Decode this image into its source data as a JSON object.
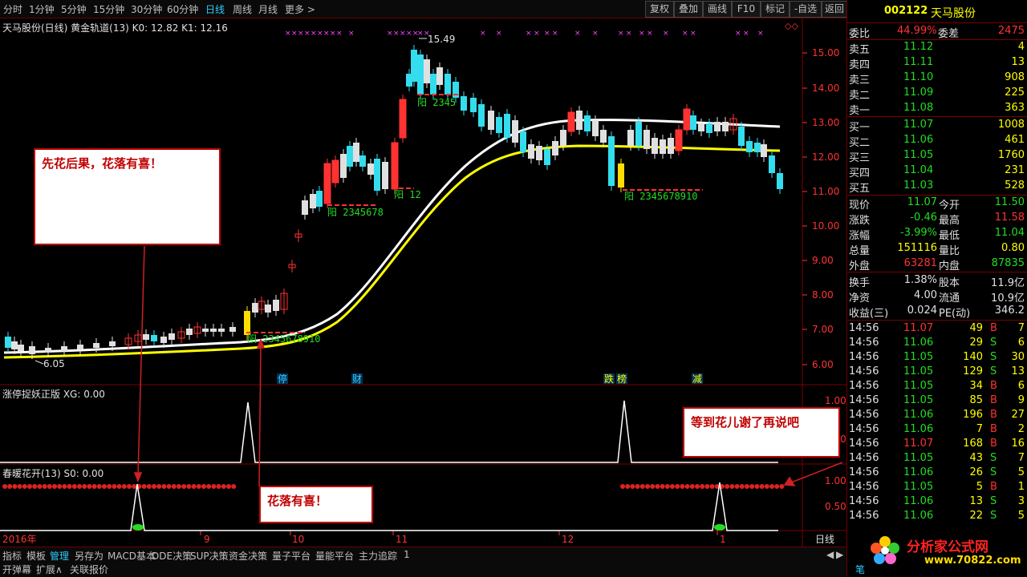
{
  "toolbar": {
    "periods": [
      "分时",
      "1分钟",
      "5分钟",
      "15分钟",
      "30分钟",
      "60分钟",
      "日线",
      "周线",
      "月线",
      "更多 >"
    ],
    "active_period": "日线",
    "buttons": [
      "复权",
      "叠加",
      "画线",
      "F10",
      "标记",
      "-自选",
      "返回"
    ]
  },
  "main_chart": {
    "title": "天马股份(日线) 黄金轨道(13) K0: 12.82 K1: 12.16",
    "high_label": "15.49",
    "low_label": "6.05",
    "yang_labels": [
      "阳 2345678",
      "阳 12",
      "阳 2345",
      "阳 2345678910",
      "阳 2345678910"
    ],
    "event_tags": [
      "停",
      "财",
      "跌",
      "榜",
      "减"
    ],
    "y_ticks": [
      "15.00",
      "14.00",
      "13.00",
      "12.00",
      "11.00",
      "10.00",
      "9.00",
      "8.00",
      "7.00",
      "6.00"
    ]
  },
  "indicator1": {
    "title": "涨停捉妖正版 XG: 0.00",
    "y_ticks": [
      "1.00",
      "0.50"
    ]
  },
  "indicator2": {
    "title": "春暖花开(13) S0: 0.00",
    "y_ticks": [
      "1.00",
      "0.50"
    ]
  },
  "x_axis": {
    "labels": [
      "2016年",
      "9",
      "10",
      "11",
      "12",
      "1"
    ],
    "period_label": "日线"
  },
  "annotations": {
    "a1": "先花后果，花落有喜！",
    "a2": "花落有喜！",
    "a3": "等到花儿谢了再说吧"
  },
  "stock": {
    "code": "002122",
    "name": "天马股份"
  },
  "order_book": {
    "wei_bi_label": "委比",
    "wei_bi": "44.99%",
    "wei_cha_label": "委差",
    "wei_cha": "2475",
    "asks": [
      {
        "label": "卖五",
        "price": "11.12",
        "vol": "4"
      },
      {
        "label": "卖四",
        "price": "11.11",
        "vol": "13"
      },
      {
        "label": "卖三",
        "price": "11.10",
        "vol": "908"
      },
      {
        "label": "卖二",
        "price": "11.09",
        "vol": "225"
      },
      {
        "label": "卖一",
        "price": "11.08",
        "vol": "363"
      }
    ],
    "bids": [
      {
        "label": "买一",
        "price": "11.07",
        "vol": "1008"
      },
      {
        "label": "买二",
        "price": "11.06",
        "vol": "461"
      },
      {
        "label": "买三",
        "price": "11.05",
        "vol": "1760"
      },
      {
        "label": "买四",
        "price": "11.04",
        "vol": "231"
      },
      {
        "label": "买五",
        "price": "11.03",
        "vol": "528"
      }
    ]
  },
  "quote": [
    {
      "l1": "现价",
      "v1": "11.07",
      "l2": "今开",
      "v2": "11.50"
    },
    {
      "l1": "涨跌",
      "v1": "-0.46",
      "l2": "最高",
      "v2": "11.58"
    },
    {
      "l1": "涨幅",
      "v1": "-3.99%",
      "l2": "最低",
      "v2": "11.04"
    },
    {
      "l1": "总量",
      "v1": "151116",
      "l2": "量比",
      "v2": "0.80"
    },
    {
      "l1": "外盘",
      "v1": "63281",
      "l2": "内盘",
      "v2": "87835"
    }
  ],
  "stats": [
    {
      "l1": "换手",
      "v1": "1.38%",
      "l2": "股本",
      "v2": "11.9亿"
    },
    {
      "l1": "净资",
      "v1": "4.00",
      "l2": "流通",
      "v2": "10.9亿"
    },
    {
      "l1": "收益(三)",
      "v1": "0.024",
      "l2": "PE(动)",
      "v2": "346.2"
    }
  ],
  "ticks": [
    {
      "time": "14:56",
      "price": "11.07",
      "vol": "49",
      "bs": "B",
      "n": "7"
    },
    {
      "time": "14:56",
      "price": "11.06",
      "vol": "29",
      "bs": "S",
      "n": "6"
    },
    {
      "time": "14:56",
      "price": "11.05",
      "vol": "140",
      "bs": "S",
      "n": "30"
    },
    {
      "time": "14:56",
      "price": "11.05",
      "vol": "129",
      "bs": "S",
      "n": "13"
    },
    {
      "time": "14:56",
      "price": "11.05",
      "vol": "34",
      "bs": "B",
      "n": "6"
    },
    {
      "time": "14:56",
      "price": "11.05",
      "vol": "85",
      "bs": "B",
      "n": "9"
    },
    {
      "time": "14:56",
      "price": "11.06",
      "vol": "196",
      "bs": "B",
      "n": "27"
    },
    {
      "time": "14:56",
      "price": "11.06",
      "vol": "7",
      "bs": "B",
      "n": "2"
    },
    {
      "time": "14:56",
      "price": "11.07",
      "vol": "168",
      "bs": "B",
      "n": "16"
    },
    {
      "time": "14:56",
      "price": "11.05",
      "vol": "43",
      "bs": "S",
      "n": "7"
    },
    {
      "time": "14:56",
      "price": "11.06",
      "vol": "26",
      "bs": "S",
      "n": "5"
    },
    {
      "time": "14:56",
      "price": "11.05",
      "vol": "5",
      "bs": "B",
      "n": "1"
    },
    {
      "time": "14:56",
      "price": "11.06",
      "vol": "13",
      "bs": "S",
      "n": "3"
    },
    {
      "time": "14:56",
      "price": "11.06",
      "vol": "22",
      "bs": "S",
      "n": "5"
    }
  ],
  "bottom_tabs": [
    "指标",
    "模板",
    "管理",
    "另存为",
    "MACD基本",
    "DDE决策",
    "SUP决策",
    "资金决策",
    "量子平台",
    "量能平台",
    "主力追踪",
    "1"
  ],
  "bottom_row2": [
    "开弹幕",
    "扩展∧",
    "关联报价"
  ],
  "watermark": {
    "site": "分析家公式网",
    "url": "www.70822.com"
  },
  "bottom_right_label": "笔"
}
